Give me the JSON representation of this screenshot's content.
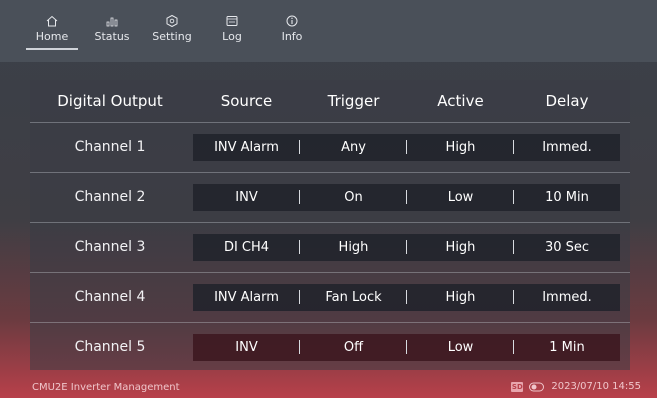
{
  "nav": [
    {
      "label": "Home",
      "icon": "home-icon"
    },
    {
      "label": "Status",
      "icon": "bar-chart-icon"
    },
    {
      "label": "Setting",
      "icon": "gear-icon"
    },
    {
      "label": "Log",
      "icon": "log-icon"
    },
    {
      "label": "Info",
      "icon": "info-icon"
    }
  ],
  "table": {
    "headers": [
      "Digital Output",
      "Source",
      "Trigger",
      "Active",
      "Delay"
    ],
    "rows": [
      {
        "channel": "Channel 1",
        "source": "INV Alarm",
        "trigger": "Any",
        "active": "High",
        "delay": "Immed."
      },
      {
        "channel": "Channel 2",
        "source": "INV",
        "trigger": "On",
        "active": "Low",
        "delay": "10 Min"
      },
      {
        "channel": "Channel 3",
        "source": "DI CH4",
        "trigger": "High",
        "active": "High",
        "delay": "30 Sec"
      },
      {
        "channel": "Channel 4",
        "source": "INV Alarm",
        "trigger": "Fan Lock",
        "active": "High",
        "delay": "Immed."
      },
      {
        "channel": "Channel 5",
        "source": "INV",
        "trigger": "Off",
        "active": "Low",
        "delay": "1 Min"
      }
    ]
  },
  "status": {
    "app_name": "CMU2E Inverter Management",
    "sd_label": "SD",
    "datetime": "2023/07/10 14:55"
  },
  "colors": {
    "accent": "#b8404a",
    "panel": "#3a3d46"
  }
}
